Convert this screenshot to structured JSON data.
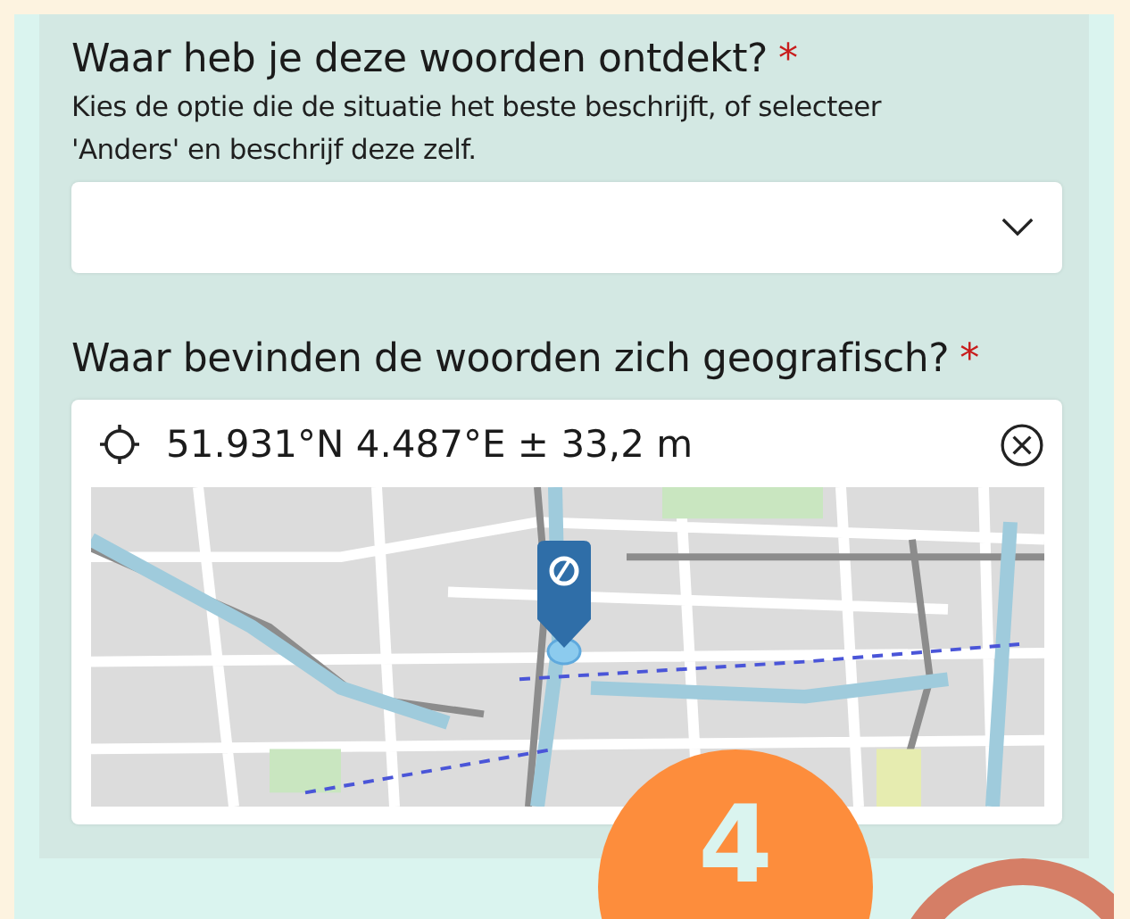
{
  "questions": [
    {
      "kind": "select",
      "label": "Waar heb je deze woorden ontdekt?",
      "required_mark": "*",
      "description": "Kies de optie die de situatie het beste beschrijft, of selecteer 'Anders' en beschrijf deze zelf."
    },
    {
      "kind": "location",
      "label": "Waar bevinden de woorden zich geografisch?",
      "required_mark": "*",
      "coordinates": "51.931°N 4.487°E ± 33,2 m"
    }
  ],
  "step_badge": {
    "number": "4"
  }
}
